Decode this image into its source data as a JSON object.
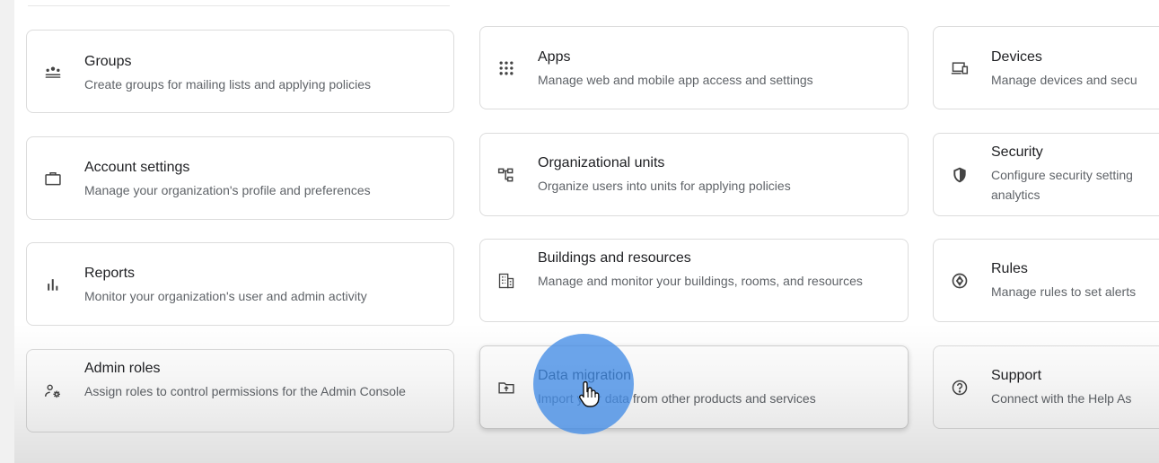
{
  "cards": [
    {
      "id": "groups",
      "icon": "groups-icon",
      "title": "Groups",
      "desc": "Create groups for mailing lists and applying policies"
    },
    {
      "id": "apps",
      "icon": "apps-grid-icon",
      "title": "Apps",
      "desc": "Manage web and mobile app access and settings"
    },
    {
      "id": "devices",
      "icon": "devices-icon",
      "title": "Devices",
      "desc": "Manage devices and secu"
    },
    {
      "id": "account_settings",
      "icon": "briefcase-icon",
      "title": "Account settings",
      "desc": "Manage your organization's profile and preferences"
    },
    {
      "id": "org_units",
      "icon": "org-units-icon",
      "title": "Organizational units",
      "desc": "Organize users into units for applying policies"
    },
    {
      "id": "security",
      "icon": "shield-icon",
      "title": "Security",
      "desc": "Configure security setting analytics"
    },
    {
      "id": "reports",
      "icon": "bar-chart-icon",
      "title": "Reports",
      "desc": "Monitor your organization's user and admin activity"
    },
    {
      "id": "buildings",
      "icon": "building-icon",
      "title": "Buildings and resources",
      "desc": "Manage and monitor your buildings, rooms, and resources"
    },
    {
      "id": "rules",
      "icon": "rules-icon",
      "title": "Rules",
      "desc": "Manage rules to set alerts"
    },
    {
      "id": "admin_roles",
      "icon": "admin-roles-icon",
      "title": "Admin roles",
      "desc": "Assign roles to control permissions for the Admin Console"
    },
    {
      "id": "data_migration",
      "icon": "folder-upload-icon",
      "title": "Data migration",
      "desc": "Import your data from other products and services"
    },
    {
      "id": "support",
      "icon": "help-icon",
      "title": "Support",
      "desc": "Connect with the Help As"
    }
  ]
}
